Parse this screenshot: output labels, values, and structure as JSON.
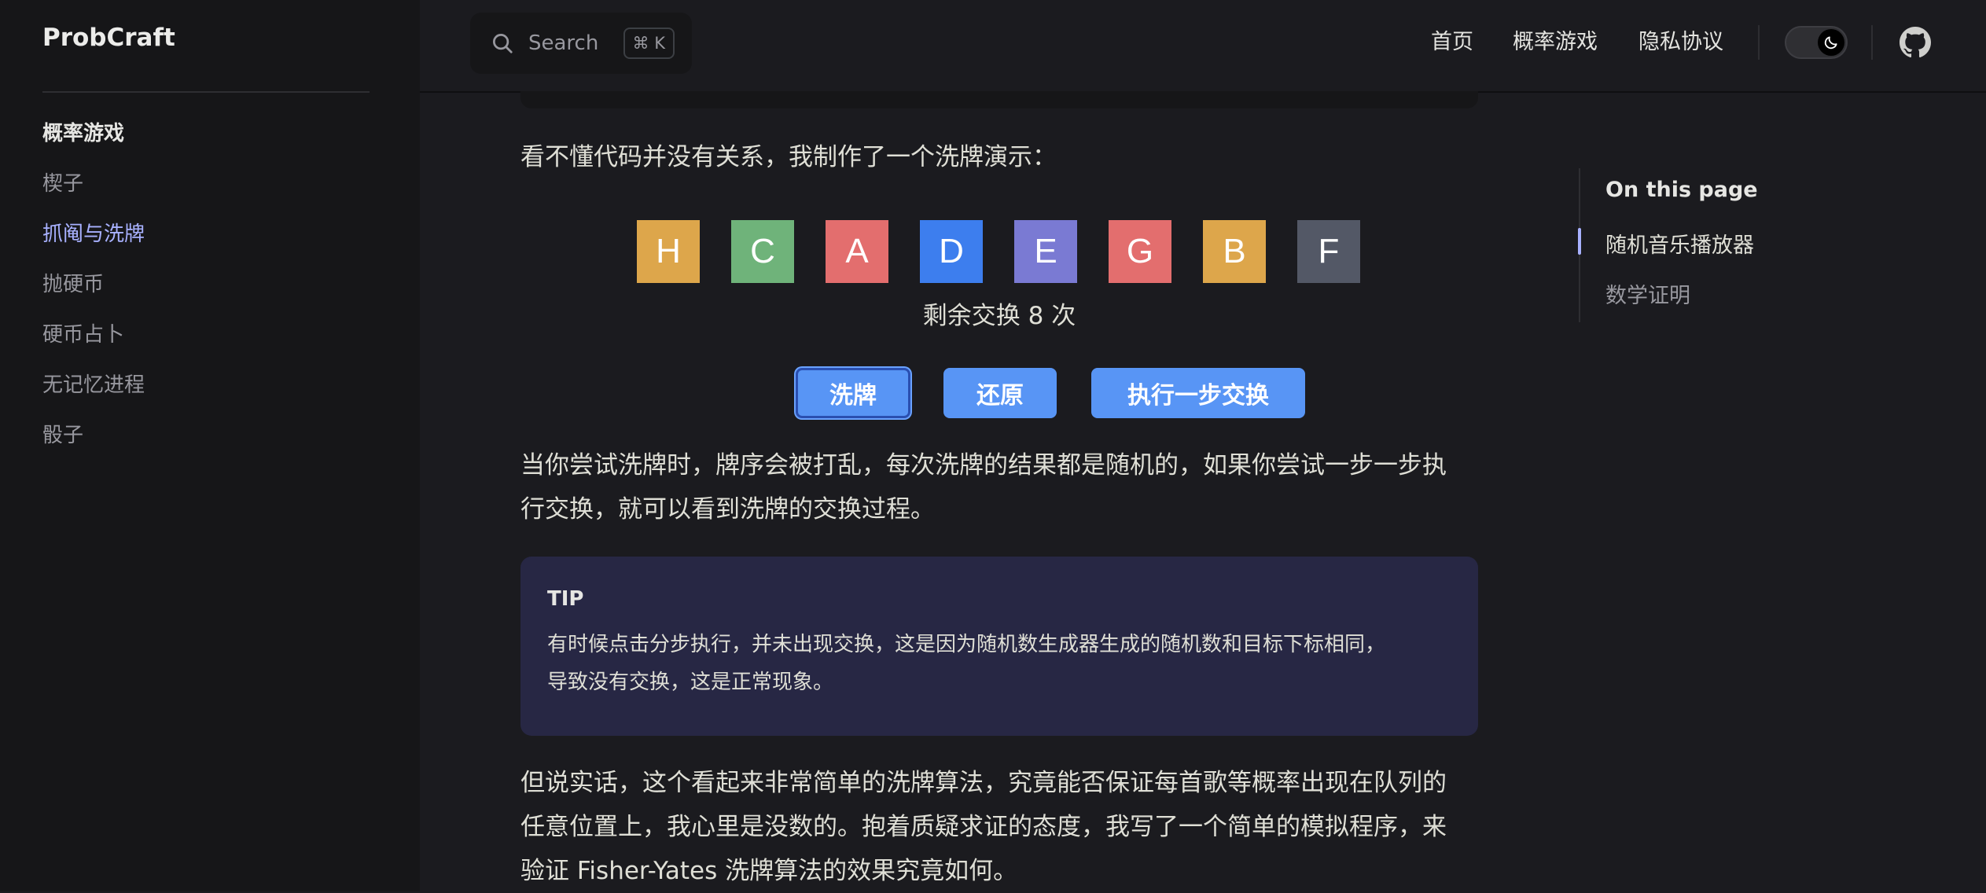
{
  "app": {
    "brand": "ProbCraft"
  },
  "sidebar": {
    "group_title": "概率游戏",
    "items": [
      {
        "label": "楔子",
        "active": false
      },
      {
        "label": "抓阄与洗牌",
        "active": true
      },
      {
        "label": "抛硬币",
        "active": false
      },
      {
        "label": "硬币占卜",
        "active": false
      },
      {
        "label": "无记忆进程",
        "active": false
      },
      {
        "label": "骰子",
        "active": false
      }
    ]
  },
  "topbar": {
    "search": {
      "label": "Search",
      "shortcut": "⌘ K"
    },
    "links": [
      "首页",
      "概率游戏",
      "隐私协议"
    ]
  },
  "content": {
    "intro": "看不懂代码并没有关系，我制作了一个洗牌演示：",
    "cards": [
      {
        "letter": "H",
        "color": "#dda64b"
      },
      {
        "letter": "C",
        "color": "#6fb37a"
      },
      {
        "letter": "A",
        "color": "#e36e6e"
      },
      {
        "letter": "D",
        "color": "#3d7eee"
      },
      {
        "letter": "E",
        "color": "#7a7ad3"
      },
      {
        "letter": "G",
        "color": "#e36e6e"
      },
      {
        "letter": "B",
        "color": "#dda64b"
      },
      {
        "letter": "F",
        "color": "#535866"
      }
    ],
    "remaining": "剩余交换 8 次",
    "buttons": {
      "shuffle": "洗牌",
      "restore": "还原",
      "step": "执行一步交换"
    },
    "desc_line1": "当你尝试洗牌时，牌序会被打乱，每次洗牌的结果都是随机的，如果你尝试一步一步执",
    "desc_line2": "行交换，就可以看到洗牌的交换过程。",
    "tip": {
      "title": "TIP",
      "line1": "有时候点击分步执行，并未出现交换，这是因为随机数生成器生成的随机数和目标下标相同，",
      "line2": "导致没有交换，这是正常现象。"
    },
    "para3_line1": "但说实话，这个看起来非常简单的洗牌算法，究竟能否保证每首歌等概率出现在队列的",
    "para3_line2": "任意位置上，我心里是没数的。抱着质疑求证的态度，我写了一个简单的模拟程序，来",
    "para3_line3": "验证 Fisher-Yates 洗牌算法的效果究竟如何。"
  },
  "outline": {
    "title": "On this page",
    "items": [
      {
        "label": "随机音乐播放器",
        "active": true
      },
      {
        "label": "数学证明",
        "active": false
      }
    ]
  }
}
